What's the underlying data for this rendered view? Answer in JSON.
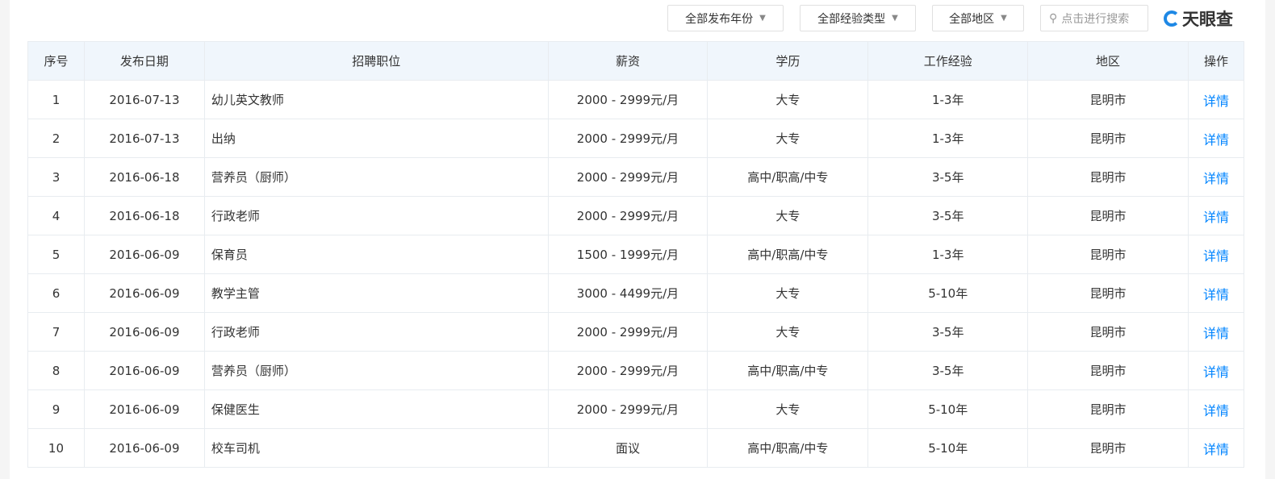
{
  "filters": {
    "year": "全部发布年份",
    "experience": "全部经验类型",
    "region": "全部地区"
  },
  "search": {
    "placeholder": "点击进行搜索"
  },
  "logo": "天眼查",
  "headers": [
    "序号",
    "发布日期",
    "招聘职位",
    "薪资",
    "学历",
    "工作经验",
    "地区",
    "操作"
  ],
  "rows": [
    [
      "1",
      "2016-07-13",
      "幼儿英文教师",
      "2000 - 2999元/月",
      "大专",
      "1-3年",
      "昆明市",
      "详情"
    ],
    [
      "2",
      "2016-07-13",
      "出纳",
      "2000 - 2999元/月",
      "大专",
      "1-3年",
      "昆明市",
      "详情"
    ],
    [
      "3",
      "2016-06-18",
      "营养员（厨师）",
      "2000 - 2999元/月",
      "高中/职高/中专",
      "3-5年",
      "昆明市",
      "详情"
    ],
    [
      "4",
      "2016-06-18",
      "行政老师",
      "2000 - 2999元/月",
      "大专",
      "3-5年",
      "昆明市",
      "详情"
    ],
    [
      "5",
      "2016-06-09",
      "保育员",
      "1500 - 1999元/月",
      "高中/职高/中专",
      "1-3年",
      "昆明市",
      "详情"
    ],
    [
      "6",
      "2016-06-09",
      "教学主管",
      "3000 - 4499元/月",
      "大专",
      "5-10年",
      "昆明市",
      "详情"
    ],
    [
      "7",
      "2016-06-09",
      "行政老师",
      "2000 - 2999元/月",
      "大专",
      "3-5年",
      "昆明市",
      "详情"
    ],
    [
      "8",
      "2016-06-09",
      "营养员（厨师）",
      "2000 - 2999元/月",
      "高中/职高/中专",
      "3-5年",
      "昆明市",
      "详情"
    ],
    [
      "9",
      "2016-06-09",
      "保健医生",
      "2000 - 2999元/月",
      "大专",
      "5-10年",
      "昆明市",
      "详情"
    ],
    [
      "10",
      "2016-06-09",
      "校车司机",
      "面议",
      "高中/职高/中专",
      "5-10年",
      "昆明市",
      "详情"
    ]
  ]
}
